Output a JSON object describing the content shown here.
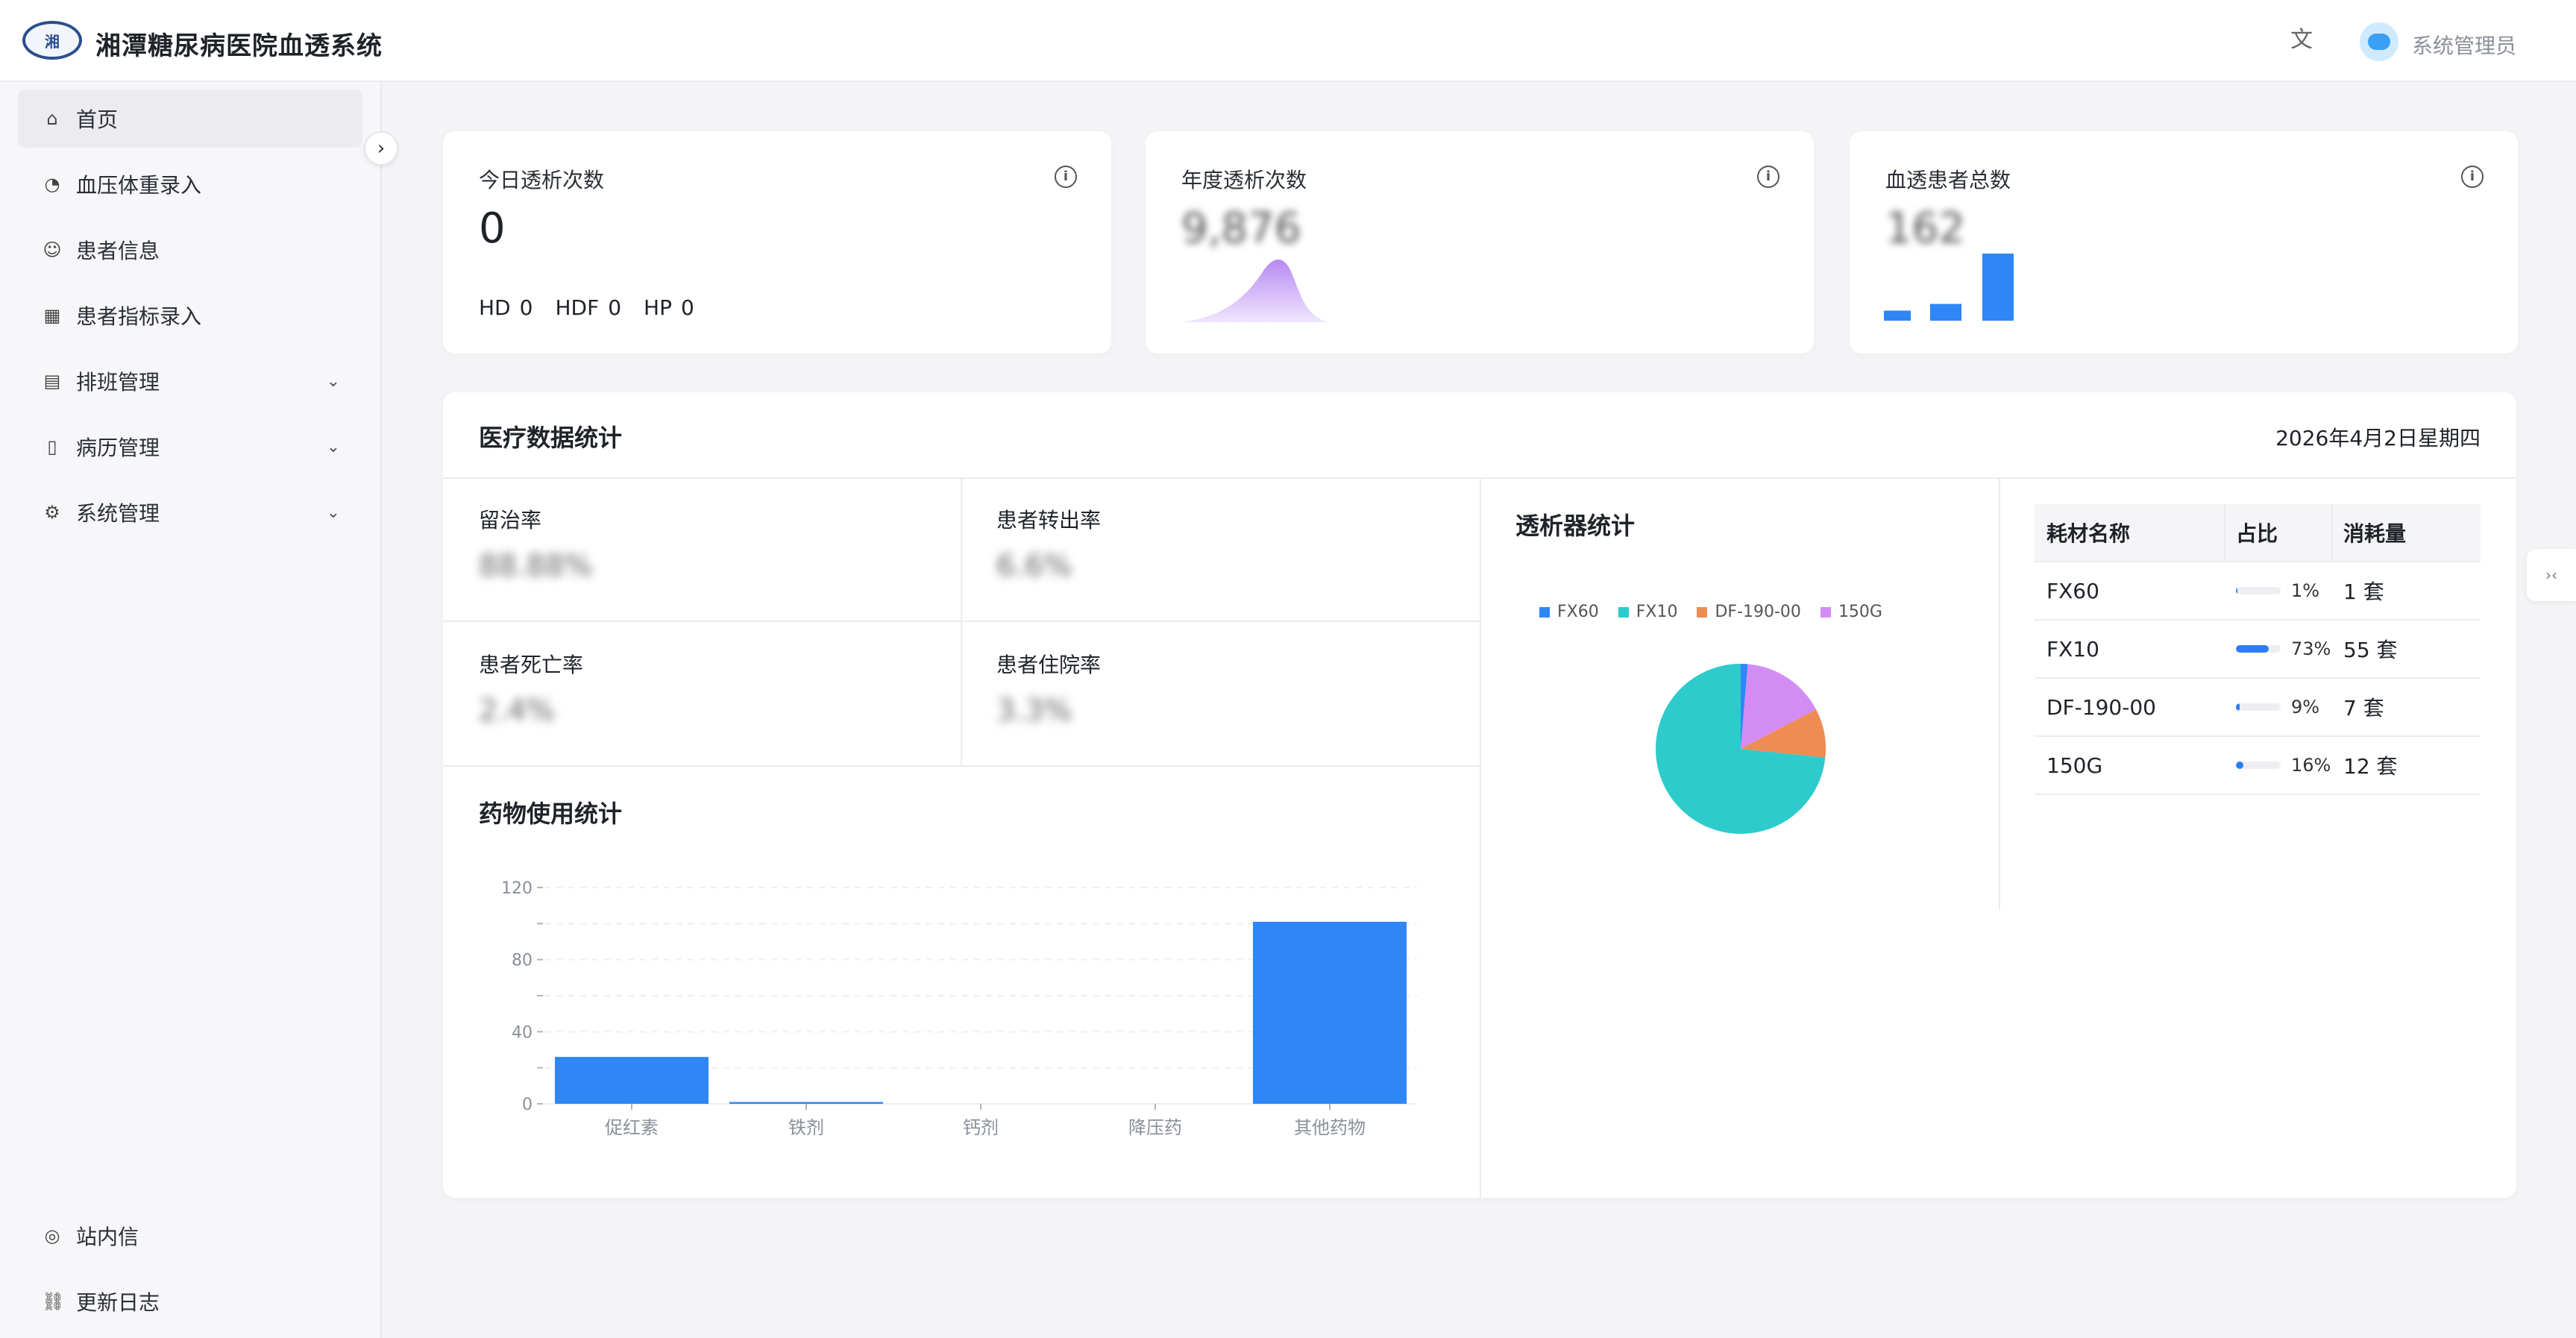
{
  "app": {
    "title": "湘潭糖尿病医院血透系统",
    "logo_text": "湘"
  },
  "header": {
    "user_name": "系统管理员",
    "translate_icon": "translate-icon"
  },
  "sidebar": {
    "items": [
      {
        "label": "首页",
        "icon": "home-icon",
        "active": true
      },
      {
        "label": "血压体重录入",
        "icon": "gauge-icon"
      },
      {
        "label": "患者信息",
        "icon": "user-icon"
      },
      {
        "label": "患者指标录入",
        "icon": "calendar-icon"
      },
      {
        "label": "排班管理",
        "icon": "clipboard-icon",
        "expandable": true
      },
      {
        "label": "病历管理",
        "icon": "file-icon",
        "expandable": true
      },
      {
        "label": "系统管理",
        "icon": "gear-icon",
        "expandable": true
      }
    ],
    "bottom_items": [
      {
        "label": "站内信",
        "icon": "message-icon"
      },
      {
        "label": "更新日志",
        "icon": "link-icon"
      }
    ]
  },
  "stats": {
    "today": {
      "title": "今日透析次数",
      "value": "0",
      "hd_label": "HD",
      "hd_value": "0",
      "hdf_label": "HDF",
      "hdf_value": "0",
      "hp_label": "HP",
      "hp_value": "0"
    },
    "year": {
      "title": "年度透析次数",
      "value": "9,876"
    },
    "patients": {
      "title": "血透患者总数",
      "value": "162",
      "mini_bars": [
        0.15,
        0.25,
        1.0
      ]
    }
  },
  "medical": {
    "title": "医疗数据统计",
    "date": "2026年4月2日星期四",
    "retention": {
      "label": "留治率",
      "value": "88.88%"
    },
    "transfer": {
      "label": "患者转出率",
      "value": "6.6%"
    },
    "death": {
      "label": "患者死亡率",
      "value": "2.4%"
    },
    "hospital": {
      "label": "患者住院率",
      "value": "3.3%"
    },
    "drug_title": "药物使用统计",
    "dialyzer_title": "透析器统计",
    "table": {
      "headers": [
        "耗材名称",
        "占比",
        "消耗量"
      ],
      "rows": [
        {
          "name": "FX60",
          "pct": "1%",
          "frac": 0.01,
          "qty": "1 套"
        },
        {
          "name": "FX10",
          "pct": "73%",
          "frac": 0.73,
          "qty": "55 套"
        },
        {
          "name": "DF-190-00",
          "pct": "9%",
          "frac": 0.09,
          "qty": "7 套"
        },
        {
          "name": "150G",
          "pct": "16%",
          "frac": 0.16,
          "qty": "12 套"
        }
      ]
    }
  },
  "colors": {
    "blue": "#2e86f7",
    "teal": "#2dcbcb",
    "orange": "#ef8c53",
    "purple": "#d48cf5"
  },
  "chart_data": [
    {
      "type": "bar",
      "title": "药物使用统计",
      "categories": [
        "促红素",
        "铁剂",
        "钙剂",
        "降压药",
        "其他药物"
      ],
      "values": [
        26,
        1,
        0,
        0,
        101
      ],
      "ylim": [
        0,
        120
      ],
      "yticks": [
        "0",
        "40",
        "80",
        "120"
      ],
      "grid": true
    },
    {
      "type": "pie",
      "title": "透析器统计",
      "series": [
        {
          "name": "FX60",
          "value": 1
        },
        {
          "name": "FX10",
          "value": 55
        },
        {
          "name": "DF-190-00",
          "value": 7
        },
        {
          "name": "150G",
          "value": 12
        }
      ],
      "legend": "top"
    }
  ]
}
